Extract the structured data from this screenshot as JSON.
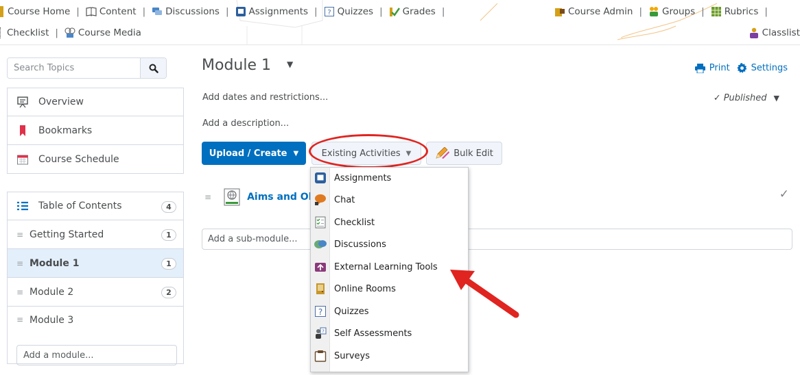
{
  "nav": {
    "row1": [
      {
        "label": "Course Home",
        "icon": "course-home-icon"
      },
      {
        "label": "Content",
        "icon": "book-icon"
      },
      {
        "label": "Discussions",
        "icon": "discussions-icon"
      },
      {
        "label": "Assignments",
        "icon": "assignments-icon"
      },
      {
        "label": "Quizzes",
        "icon": "quizzes-icon"
      },
      {
        "label": "Grades",
        "icon": "grades-icon"
      },
      {
        "label": "Course Admin",
        "icon": "course-admin-icon"
      },
      {
        "label": "Groups",
        "icon": "groups-icon"
      },
      {
        "label": "Rubrics",
        "icon": "rubrics-icon"
      }
    ],
    "row2_left": [
      {
        "label": "Checklist",
        "icon": "checklist-icon"
      },
      {
        "label": "Course Media",
        "icon": "course-media-icon"
      }
    ],
    "classlist": {
      "label": "Classlist",
      "icon": "classlist-icon"
    },
    "separator": "|"
  },
  "sidebar": {
    "search_placeholder": "Search Topics",
    "top_items": [
      {
        "label": "Overview",
        "icon": "overview-icon"
      },
      {
        "label": "Bookmarks",
        "icon": "bookmark-icon"
      },
      {
        "label": "Course Schedule",
        "icon": "calendar-icon"
      }
    ],
    "toc": {
      "label": "Table of Contents",
      "count": "4",
      "icon": "list-icon"
    },
    "modules": [
      {
        "label": "Getting Started",
        "count": "1"
      },
      {
        "label": "Module 1",
        "count": "1"
      },
      {
        "label": "Module 2",
        "count": "2"
      },
      {
        "label": "Module 3",
        "count": ""
      }
    ],
    "add_module_placeholder": "Add a module..."
  },
  "main": {
    "title": "Module 1",
    "print_label": "Print",
    "settings_label": "Settings",
    "add_dates": "Add dates and restrictions...",
    "published": "Published",
    "add_description": "Add a description...",
    "upload_create": "Upload / Create",
    "existing_activities": "Existing Activities",
    "bulk_edit": "Bulk Edit",
    "topic_title": "Aims and Ob",
    "add_submodule_placeholder": "Add a sub-module..."
  },
  "dropdown": {
    "items": [
      {
        "label": "Assignments",
        "icon": "assignments-icon"
      },
      {
        "label": "Chat",
        "icon": "chat-icon"
      },
      {
        "label": "Checklist",
        "icon": "checklist-icon"
      },
      {
        "label": "Discussions",
        "icon": "discussions-icon"
      },
      {
        "label": "External Learning Tools",
        "icon": "external-tools-icon"
      },
      {
        "label": "Online Rooms",
        "icon": "online-rooms-icon"
      },
      {
        "label": "Quizzes",
        "icon": "quizzes-icon"
      },
      {
        "label": "Self Assessments",
        "icon": "self-assessment-icon"
      },
      {
        "label": "Surveys",
        "icon": "surveys-icon"
      }
    ]
  },
  "colors": {
    "accent": "#006fbf",
    "annotation_red": "#e02420",
    "active_row": "#e3effa",
    "text": "#494c4e"
  }
}
